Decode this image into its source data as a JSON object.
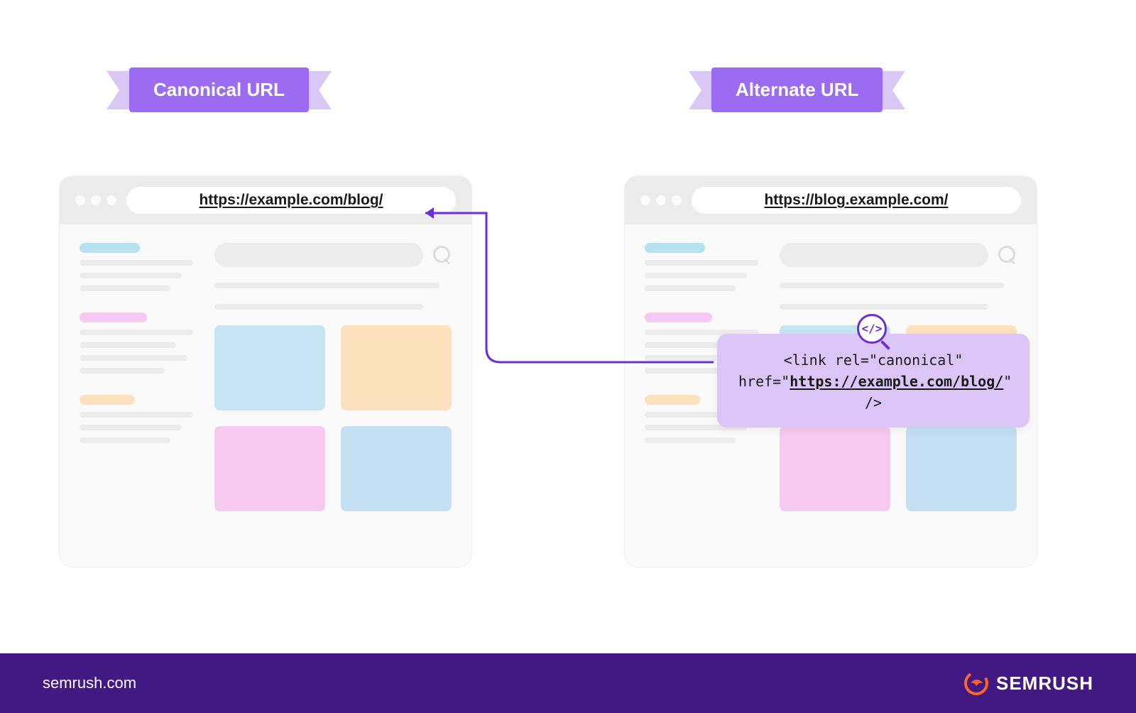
{
  "ribbons": {
    "left": "Canonical URL",
    "right": "Alternate URL"
  },
  "browsers": {
    "canonical_url": "https://example.com/blog/",
    "alternate_url": "https://blog.example.com/"
  },
  "callout": {
    "line1": "<link rel=\"canonical\"",
    "line2_prefix": "href=\"",
    "line2_url": "https://example.com/blog/",
    "line2_suffix": "\" />",
    "icon_label": "</>"
  },
  "footer": {
    "site": "semrush.com",
    "brand": "SEMRUSH"
  },
  "colors": {
    "purple": "#9b6cf2",
    "lilac": "#dbc6f7",
    "deep_purple": "#421983",
    "arrow": "#6a2fd6",
    "orange": "#ff642d"
  }
}
